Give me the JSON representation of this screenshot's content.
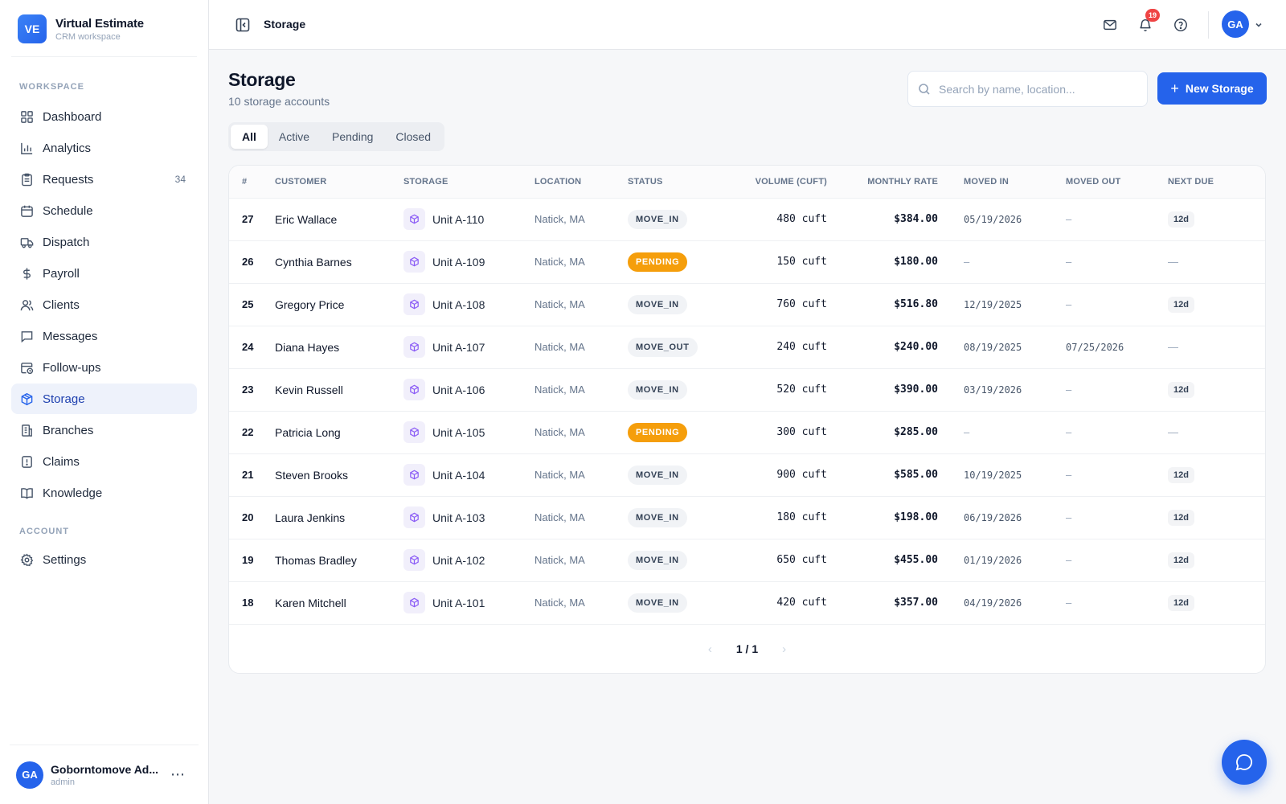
{
  "brand": {
    "logo": "VE",
    "name": "Virtual Estimate",
    "subtitle": "CRM workspace"
  },
  "sidebar": {
    "workspace_label": "WORKSPACE",
    "account_label": "ACCOUNT",
    "items": [
      {
        "label": "Dashboard",
        "icon": "dashboard-icon"
      },
      {
        "label": "Analytics",
        "icon": "analytics-icon"
      },
      {
        "label": "Requests",
        "icon": "requests-icon",
        "count": "34"
      },
      {
        "label": "Schedule",
        "icon": "calendar-icon"
      },
      {
        "label": "Dispatch",
        "icon": "truck-icon"
      },
      {
        "label": "Payroll",
        "icon": "dollar-icon"
      },
      {
        "label": "Clients",
        "icon": "users-icon"
      },
      {
        "label": "Messages",
        "icon": "message-icon"
      },
      {
        "label": "Follow-ups",
        "icon": "calendar-clock-icon"
      },
      {
        "label": "Storage",
        "icon": "box-icon",
        "active": true
      },
      {
        "label": "Branches",
        "icon": "building-icon"
      },
      {
        "label": "Claims",
        "icon": "alert-file-icon"
      },
      {
        "label": "Knowledge",
        "icon": "book-icon"
      }
    ],
    "account_items": [
      {
        "label": "Settings",
        "icon": "gear-icon"
      }
    ],
    "user": {
      "initials": "GA",
      "name": "Goborntomove Ad...",
      "role": "admin"
    }
  },
  "topbar": {
    "title": "Storage",
    "notifications_count": "19",
    "avatar_initials": "GA"
  },
  "main": {
    "title": "Storage",
    "subtitle": "10 storage accounts",
    "search_placeholder": "Search by name, location...",
    "new_button": "New Storage",
    "tabs": [
      "All",
      "Active",
      "Pending",
      "Closed"
    ],
    "active_tab": "All",
    "columns": [
      "#",
      "CUSTOMER",
      "STORAGE",
      "LOCATION",
      "STATUS",
      "VOLUME (CUFT)",
      "MONTHLY RATE",
      "MOVED IN",
      "MOVED OUT",
      "NEXT DUE"
    ],
    "rows": [
      {
        "id": "27",
        "customer": "Eric Wallace",
        "storage": "Unit A-110",
        "location": "Natick, MA",
        "status": "MOVE_IN",
        "volume": "480 cuft",
        "rate": "$384.00",
        "moved_in": "05/19/2026",
        "moved_out": "—",
        "next_due": "12d"
      },
      {
        "id": "26",
        "customer": "Cynthia Barnes",
        "storage": "Unit A-109",
        "location": "Natick, MA",
        "status": "PENDING",
        "volume": "150 cuft",
        "rate": "$180.00",
        "moved_in": "—",
        "moved_out": "—",
        "next_due": "—"
      },
      {
        "id": "25",
        "customer": "Gregory Price",
        "storage": "Unit A-108",
        "location": "Natick, MA",
        "status": "MOVE_IN",
        "volume": "760 cuft",
        "rate": "$516.80",
        "moved_in": "12/19/2025",
        "moved_out": "—",
        "next_due": "12d"
      },
      {
        "id": "24",
        "customer": "Diana Hayes",
        "storage": "Unit A-107",
        "location": "Natick, MA",
        "status": "MOVE_OUT",
        "volume": "240 cuft",
        "rate": "$240.00",
        "moved_in": "08/19/2025",
        "moved_out": "07/25/2026",
        "next_due": "—"
      },
      {
        "id": "23",
        "customer": "Kevin Russell",
        "storage": "Unit A-106",
        "location": "Natick, MA",
        "status": "MOVE_IN",
        "volume": "520 cuft",
        "rate": "$390.00",
        "moved_in": "03/19/2026",
        "moved_out": "—",
        "next_due": "12d"
      },
      {
        "id": "22",
        "customer": "Patricia Long",
        "storage": "Unit A-105",
        "location": "Natick, MA",
        "status": "PENDING",
        "volume": "300 cuft",
        "rate": "$285.00",
        "moved_in": "—",
        "moved_out": "—",
        "next_due": "—"
      },
      {
        "id": "21",
        "customer": "Steven Brooks",
        "storage": "Unit A-104",
        "location": "Natick, MA",
        "status": "MOVE_IN",
        "volume": "900 cuft",
        "rate": "$585.00",
        "moved_in": "10/19/2025",
        "moved_out": "—",
        "next_due": "12d"
      },
      {
        "id": "20",
        "customer": "Laura Jenkins",
        "storage": "Unit A-103",
        "location": "Natick, MA",
        "status": "MOVE_IN",
        "volume": "180 cuft",
        "rate": "$198.00",
        "moved_in": "06/19/2026",
        "moved_out": "—",
        "next_due": "12d"
      },
      {
        "id": "19",
        "customer": "Thomas Bradley",
        "storage": "Unit A-102",
        "location": "Natick, MA",
        "status": "MOVE_IN",
        "volume": "650 cuft",
        "rate": "$455.00",
        "moved_in": "01/19/2026",
        "moved_out": "—",
        "next_due": "12d"
      },
      {
        "id": "18",
        "customer": "Karen Mitchell",
        "storage": "Unit A-101",
        "location": "Natick, MA",
        "status": "MOVE_IN",
        "volume": "420 cuft",
        "rate": "$357.00",
        "moved_in": "04/19/2026",
        "moved_out": "—",
        "next_due": "12d"
      }
    ],
    "pagination": {
      "label": "1 / 1",
      "prev": "‹",
      "next": "›"
    }
  },
  "colors": {
    "accent": "#2563eb",
    "pending": "#f59e0b",
    "badge_red": "#ef4444",
    "storage_icon": "#8b5cf6"
  }
}
